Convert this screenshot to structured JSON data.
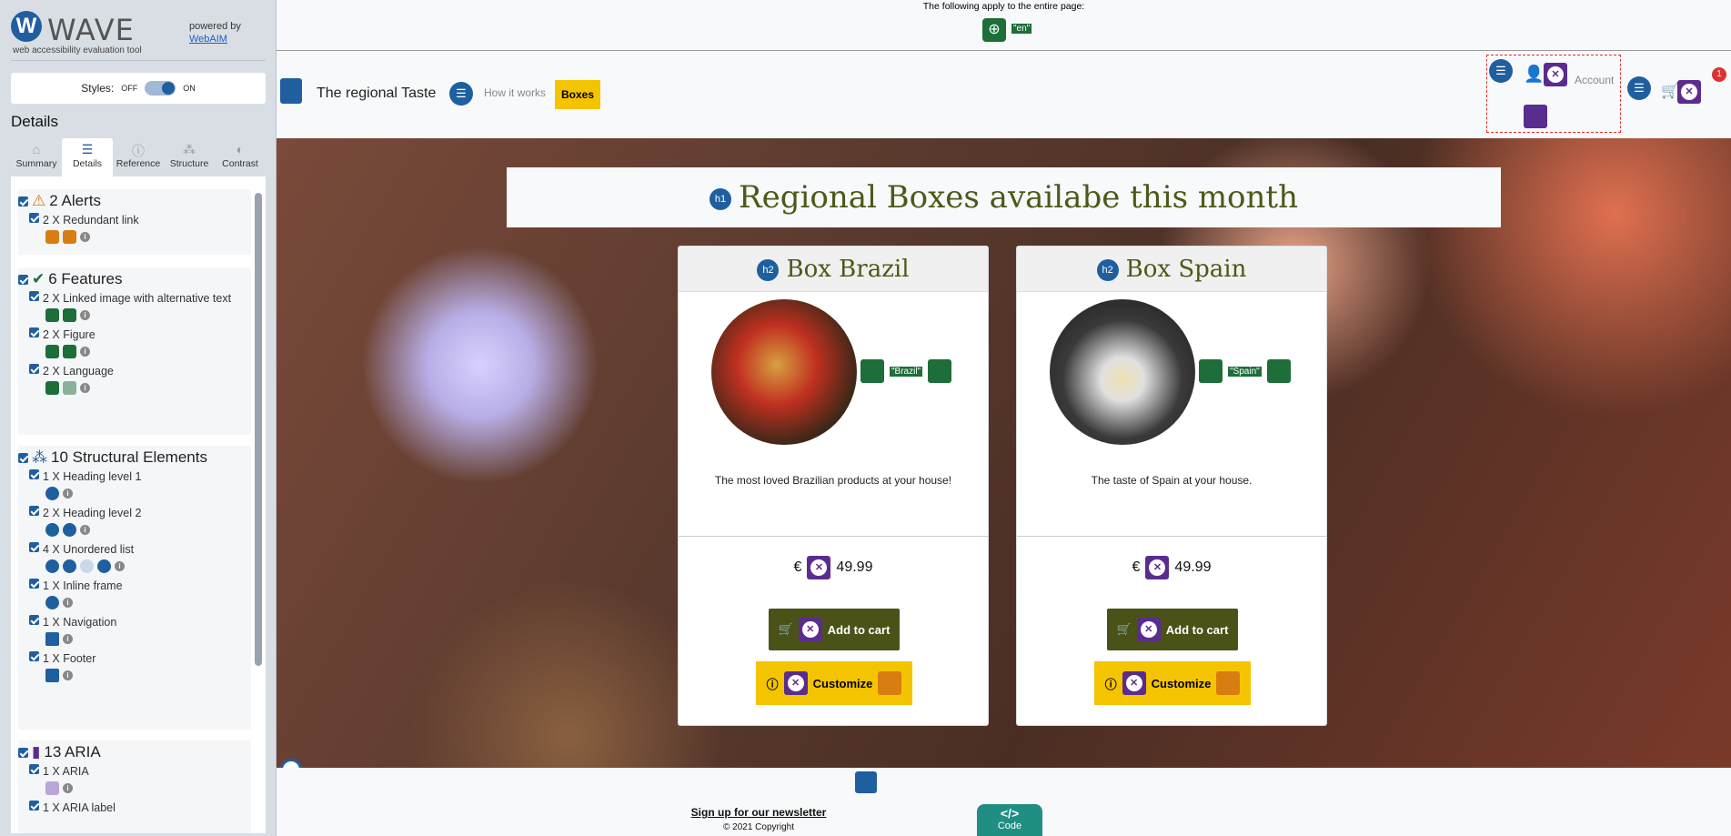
{
  "wave": {
    "title": "WAVE",
    "subtitle": "web accessibility evaluation tool",
    "powered_by": "powered by",
    "webaim": "WebAIM",
    "styles": {
      "label": "Styles:",
      "off": "OFF",
      "on": "ON"
    },
    "details_heading": "Details",
    "tabs": [
      {
        "label": "Summary"
      },
      {
        "label": "Details"
      },
      {
        "label": "Reference"
      },
      {
        "label": "Structure"
      },
      {
        "label": "Contrast"
      }
    ],
    "alerts": {
      "title": "2 Alerts",
      "items": [
        "2 X Redundant link"
      ]
    },
    "features": {
      "title": "6 Features",
      "items": [
        "2 X Linked image with alternative text",
        "2 X Figure",
        "2 X Language"
      ]
    },
    "structure": {
      "title": "10 Structural Elements",
      "items": [
        "1 X Heading level 1",
        "2 X Heading level 2",
        "4 X Unordered list",
        "1 X Inline frame",
        "1 X Navigation",
        "1 X Footer"
      ]
    },
    "aria": {
      "title": "13 ARIA",
      "items": [
        "1 X ARIA",
        "1 X ARIA label"
      ]
    }
  },
  "site": {
    "top_notice": "The following apply to the entire page:",
    "lang": "\"en\"",
    "brand": "The regional Taste",
    "nav": {
      "how": "How it works",
      "boxes": "Boxes",
      "account": "Account",
      "cart_count": "1"
    },
    "heading": "Regional Boxes availabe this month",
    "h1_badge": "h1",
    "h2_badge": "h2",
    "cards": [
      {
        "title": "Box Brazil",
        "alt": "\"Brazil\"",
        "desc": "The most loved Brazilian products at your house!",
        "currency": "€",
        "price": "49.99",
        "add": "Add to cart",
        "customize": "Customize"
      },
      {
        "title": "Box Spain",
        "alt": "\"Spain\"",
        "desc": "The taste of Spain at your house.",
        "currency": "€",
        "price": "49.99",
        "add": "Add to cart",
        "customize": "Customize"
      }
    ],
    "footer": {
      "newsletter": "Sign up for our newsletter",
      "copyright": "© 2021 Copyright",
      "code": "Code",
      "code_icon": "</>"
    }
  }
}
